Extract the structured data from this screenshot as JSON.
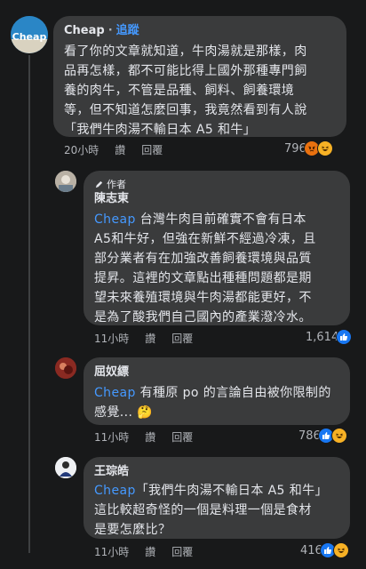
{
  "comments": [
    {
      "name": "Cheap",
      "follow": "追蹤",
      "avatar_text": "Cheap",
      "lines": [
        "看了你的文章就知道，牛肉湯就是那樣，肉",
        "品再怎樣，都不可能比得上國外那種專門飼",
        "養的肉牛，不管是品種、飼料、飼養環境",
        "等，但不知道怎麼回事，我竟然看到有人說",
        "「我們牛肉湯不輸日本 A5 和牛」"
      ],
      "time": "20小時",
      "like": "讚",
      "reply": "回覆",
      "reaction_count": "796",
      "reactions": [
        "angry-icon",
        "haha-icon"
      ]
    },
    {
      "name": "陳志東",
      "author_label": "作者",
      "mention": "Cheap",
      "lines": [
        " 台灣牛肉目前確實不會有日本",
        "A5和牛好，但強在新鮮不經過冷凍，且",
        "部分業者有在加強改善飼養環境與品質",
        "提昇。這裡的文章點出種種問題都是期",
        "望未來養殖環境與牛肉湯都能更好，不",
        "是為了酸我們自己國內的產業潑冷水。"
      ],
      "time": "11小時",
      "like": "讚",
      "reply": "回覆",
      "reaction_count": "1,614",
      "reactions": [
        "like-icon"
      ]
    },
    {
      "name": "屈奴縹",
      "mention": "Cheap",
      "lines": [
        " 有種原 po 的言論自由被你限制的",
        "感覺... 🤔"
      ],
      "time": "11小時",
      "like": "讚",
      "reply": "回覆",
      "reaction_count": "786",
      "reactions": [
        "like-icon",
        "haha-icon"
      ]
    },
    {
      "name": "王琮皓",
      "mention": "Cheap",
      "lines": [
        "「我們牛肉湯不輸日本 A5 和牛」",
        "這比較超奇怪的一個是料理一個是食材",
        "是要怎麼比？"
      ],
      "time": "11小時",
      "like": "讚",
      "reply": "回覆",
      "reaction_count": "416",
      "reactions": [
        "like-icon",
        "haha-icon"
      ]
    }
  ]
}
